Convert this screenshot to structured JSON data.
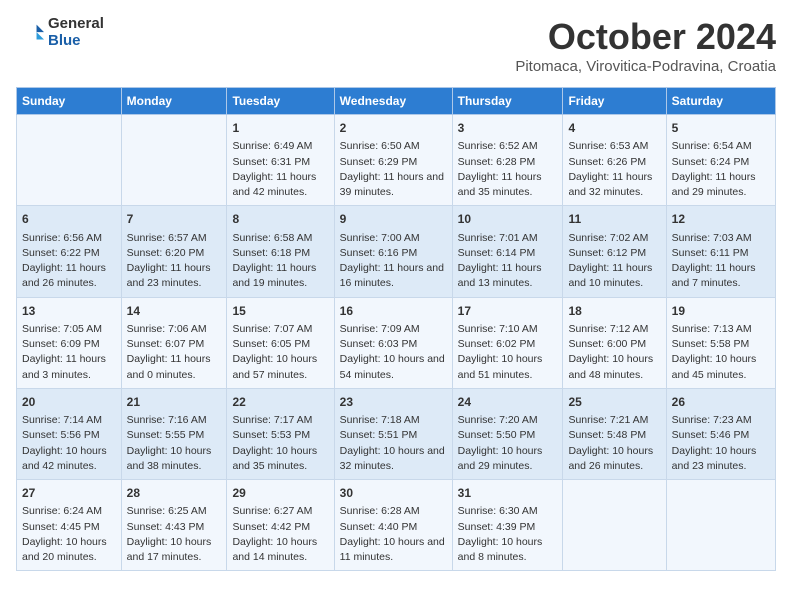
{
  "header": {
    "logo_general": "General",
    "logo_blue": "Blue",
    "main_title": "October 2024",
    "subtitle": "Pitomaca, Virovitica-Podravina, Croatia"
  },
  "days_of_week": [
    "Sunday",
    "Monday",
    "Tuesday",
    "Wednesday",
    "Thursday",
    "Friday",
    "Saturday"
  ],
  "weeks": [
    [
      {
        "day": "",
        "info": ""
      },
      {
        "day": "",
        "info": ""
      },
      {
        "day": "1",
        "info": "Sunrise: 6:49 AM\nSunset: 6:31 PM\nDaylight: 11 hours and 42 minutes."
      },
      {
        "day": "2",
        "info": "Sunrise: 6:50 AM\nSunset: 6:29 PM\nDaylight: 11 hours and 39 minutes."
      },
      {
        "day": "3",
        "info": "Sunrise: 6:52 AM\nSunset: 6:28 PM\nDaylight: 11 hours and 35 minutes."
      },
      {
        "day": "4",
        "info": "Sunrise: 6:53 AM\nSunset: 6:26 PM\nDaylight: 11 hours and 32 minutes."
      },
      {
        "day": "5",
        "info": "Sunrise: 6:54 AM\nSunset: 6:24 PM\nDaylight: 11 hours and 29 minutes."
      }
    ],
    [
      {
        "day": "6",
        "info": "Sunrise: 6:56 AM\nSunset: 6:22 PM\nDaylight: 11 hours and 26 minutes."
      },
      {
        "day": "7",
        "info": "Sunrise: 6:57 AM\nSunset: 6:20 PM\nDaylight: 11 hours and 23 minutes."
      },
      {
        "day": "8",
        "info": "Sunrise: 6:58 AM\nSunset: 6:18 PM\nDaylight: 11 hours and 19 minutes."
      },
      {
        "day": "9",
        "info": "Sunrise: 7:00 AM\nSunset: 6:16 PM\nDaylight: 11 hours and 16 minutes."
      },
      {
        "day": "10",
        "info": "Sunrise: 7:01 AM\nSunset: 6:14 PM\nDaylight: 11 hours and 13 minutes."
      },
      {
        "day": "11",
        "info": "Sunrise: 7:02 AM\nSunset: 6:12 PM\nDaylight: 11 hours and 10 minutes."
      },
      {
        "day": "12",
        "info": "Sunrise: 7:03 AM\nSunset: 6:11 PM\nDaylight: 11 hours and 7 minutes."
      }
    ],
    [
      {
        "day": "13",
        "info": "Sunrise: 7:05 AM\nSunset: 6:09 PM\nDaylight: 11 hours and 3 minutes."
      },
      {
        "day": "14",
        "info": "Sunrise: 7:06 AM\nSunset: 6:07 PM\nDaylight: 11 hours and 0 minutes."
      },
      {
        "day": "15",
        "info": "Sunrise: 7:07 AM\nSunset: 6:05 PM\nDaylight: 10 hours and 57 minutes."
      },
      {
        "day": "16",
        "info": "Sunrise: 7:09 AM\nSunset: 6:03 PM\nDaylight: 10 hours and 54 minutes."
      },
      {
        "day": "17",
        "info": "Sunrise: 7:10 AM\nSunset: 6:02 PM\nDaylight: 10 hours and 51 minutes."
      },
      {
        "day": "18",
        "info": "Sunrise: 7:12 AM\nSunset: 6:00 PM\nDaylight: 10 hours and 48 minutes."
      },
      {
        "day": "19",
        "info": "Sunrise: 7:13 AM\nSunset: 5:58 PM\nDaylight: 10 hours and 45 minutes."
      }
    ],
    [
      {
        "day": "20",
        "info": "Sunrise: 7:14 AM\nSunset: 5:56 PM\nDaylight: 10 hours and 42 minutes."
      },
      {
        "day": "21",
        "info": "Sunrise: 7:16 AM\nSunset: 5:55 PM\nDaylight: 10 hours and 38 minutes."
      },
      {
        "day": "22",
        "info": "Sunrise: 7:17 AM\nSunset: 5:53 PM\nDaylight: 10 hours and 35 minutes."
      },
      {
        "day": "23",
        "info": "Sunrise: 7:18 AM\nSunset: 5:51 PM\nDaylight: 10 hours and 32 minutes."
      },
      {
        "day": "24",
        "info": "Sunrise: 7:20 AM\nSunset: 5:50 PM\nDaylight: 10 hours and 29 minutes."
      },
      {
        "day": "25",
        "info": "Sunrise: 7:21 AM\nSunset: 5:48 PM\nDaylight: 10 hours and 26 minutes."
      },
      {
        "day": "26",
        "info": "Sunrise: 7:23 AM\nSunset: 5:46 PM\nDaylight: 10 hours and 23 minutes."
      }
    ],
    [
      {
        "day": "27",
        "info": "Sunrise: 6:24 AM\nSunset: 4:45 PM\nDaylight: 10 hours and 20 minutes."
      },
      {
        "day": "28",
        "info": "Sunrise: 6:25 AM\nSunset: 4:43 PM\nDaylight: 10 hours and 17 minutes."
      },
      {
        "day": "29",
        "info": "Sunrise: 6:27 AM\nSunset: 4:42 PM\nDaylight: 10 hours and 14 minutes."
      },
      {
        "day": "30",
        "info": "Sunrise: 6:28 AM\nSunset: 4:40 PM\nDaylight: 10 hours and 11 minutes."
      },
      {
        "day": "31",
        "info": "Sunrise: 6:30 AM\nSunset: 4:39 PM\nDaylight: 10 hours and 8 minutes."
      },
      {
        "day": "",
        "info": ""
      },
      {
        "day": "",
        "info": ""
      }
    ]
  ]
}
